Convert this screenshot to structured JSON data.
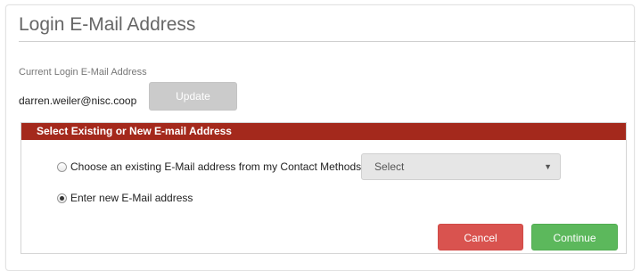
{
  "header": {
    "title": "Login E-Mail Address"
  },
  "current": {
    "label": "Current Login E-Mail Address",
    "email": "darren.weiler@nisc.coop",
    "update_label": "Update"
  },
  "section": {
    "title": "Select Existing or New E-mail Address",
    "option_existing_label": "Choose an existing E-Mail address from my Contact Methods",
    "option_new_label": "Enter new E-Mail address",
    "selected_option": "new",
    "select_value": "Select",
    "select_arrow_glyph": "▼"
  },
  "actions": {
    "cancel_label": "Cancel",
    "continue_label": "Continue"
  },
  "colors": {
    "section_header_bg": "#a4291c",
    "cancel_bg": "#d9534f",
    "continue_bg": "#5cb85c",
    "update_disabled_bg": "#cbcbcb"
  },
  "icons": {
    "select_arrow": "caret-down-icon"
  }
}
